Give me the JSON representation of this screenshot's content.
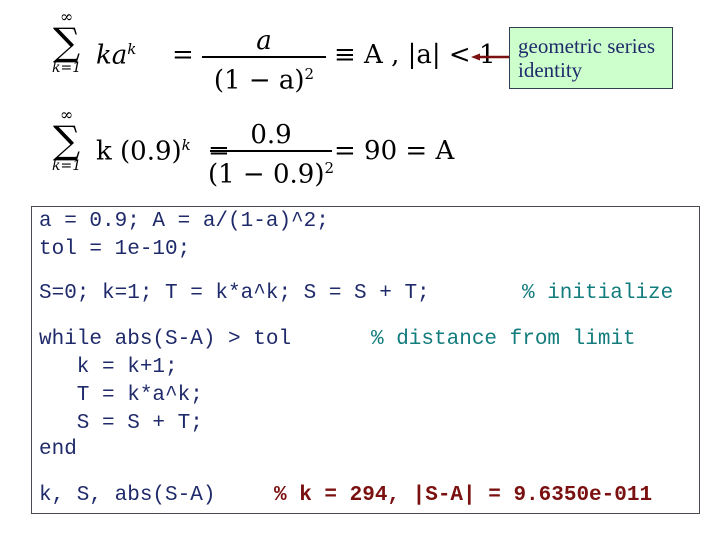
{
  "formula1": {
    "sum_upper": "∞",
    "sum_symbol": "∑",
    "sum_lower": "k=1",
    "term_base": "ka",
    "term_exp": "k",
    "eq1": "=",
    "numerator": "a",
    "denominator_base": "(1 − a)",
    "denominator_exp": "2",
    "rest": "≡ A ,    |a| < 1"
  },
  "formula2": {
    "sum_upper": "∞",
    "sum_symbol": "∑",
    "sum_lower": "k=1",
    "term_base": "k (0.9)",
    "term_exp": "k",
    "eq1": "=",
    "numerator": "0.9",
    "denominator_base": "(1 − 0.9)",
    "denominator_exp": "2",
    "rest": "= 90 = A"
  },
  "callout": {
    "line1": "geometric series",
    "line2": "identity",
    "background": "#ccffcc",
    "arrow_color": "#7a1010"
  },
  "code": {
    "lines": [
      {
        "code": "a = 0.9; A = a/(1-a)^2;",
        "comment": ""
      },
      {
        "code": "tol = 1e-10;",
        "comment": ""
      },
      {
        "code": "S=0; k=1; T = k*a^k; S = S + T;",
        "comment": "% initialize"
      },
      {
        "code": "while abs(S-A) > tol",
        "comment": "% distance from limit"
      },
      {
        "code": "   k = k+1;",
        "comment": ""
      },
      {
        "code": "   T = k*a^k;",
        "comment": ""
      },
      {
        "code": "   S = S + T;",
        "comment": ""
      },
      {
        "code": "end",
        "comment": ""
      },
      {
        "code": "k, S, abs(S-A)",
        "comment": "% k = 294, |S-A| = 9.6350e-011"
      }
    ],
    "colors": {
      "code": "#1f2a6a",
      "comment": "#137c7c",
      "result_comment": "#7a1010"
    }
  }
}
